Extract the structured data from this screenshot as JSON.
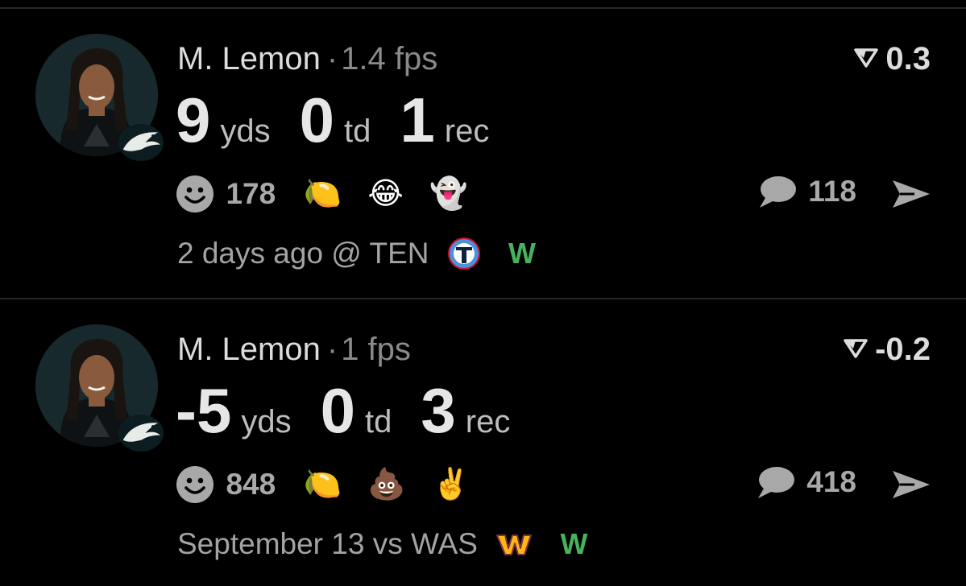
{
  "cards": [
    {
      "player": "M. Lemon",
      "fps": "1.4 fps",
      "score": "0.3",
      "stats": [
        {
          "value": "9",
          "unit": "yds"
        },
        {
          "value": "0",
          "unit": "td"
        },
        {
          "value": "1",
          "unit": "rec"
        }
      ],
      "reaction_count": "178",
      "emojis": [
        "🍋",
        "😂",
        "👻"
      ],
      "comment_count": "118",
      "when": "2 days ago @ TEN",
      "result": "W",
      "team_logo_icon": "titans-logo-icon"
    },
    {
      "player": "M. Lemon",
      "fps": "1 fps",
      "score": "-0.2",
      "stats": [
        {
          "value": "-5",
          "unit": "yds"
        },
        {
          "value": "0",
          "unit": "td"
        },
        {
          "value": "3",
          "unit": "rec"
        }
      ],
      "reaction_count": "848",
      "emojis": [
        "🍋",
        "💩",
        "✌️"
      ],
      "comment_count": "418",
      "when": "September 13 vs WAS",
      "result": "W",
      "team_logo_icon": "commanders-logo-icon"
    }
  ],
  "colors": {
    "background": "#000000",
    "text_primary": "#dcdcdc",
    "text_secondary": "#8a8a8a",
    "win": "#46b35c",
    "divider": "#262626"
  },
  "icons": {
    "avatar": "player-photo",
    "team": "eagles-logo-icon",
    "reaction": "smiley-icon",
    "comment": "chat-bubble-icon",
    "share": "send-arrow-icon",
    "score": "funnel-triangle-icon"
  }
}
